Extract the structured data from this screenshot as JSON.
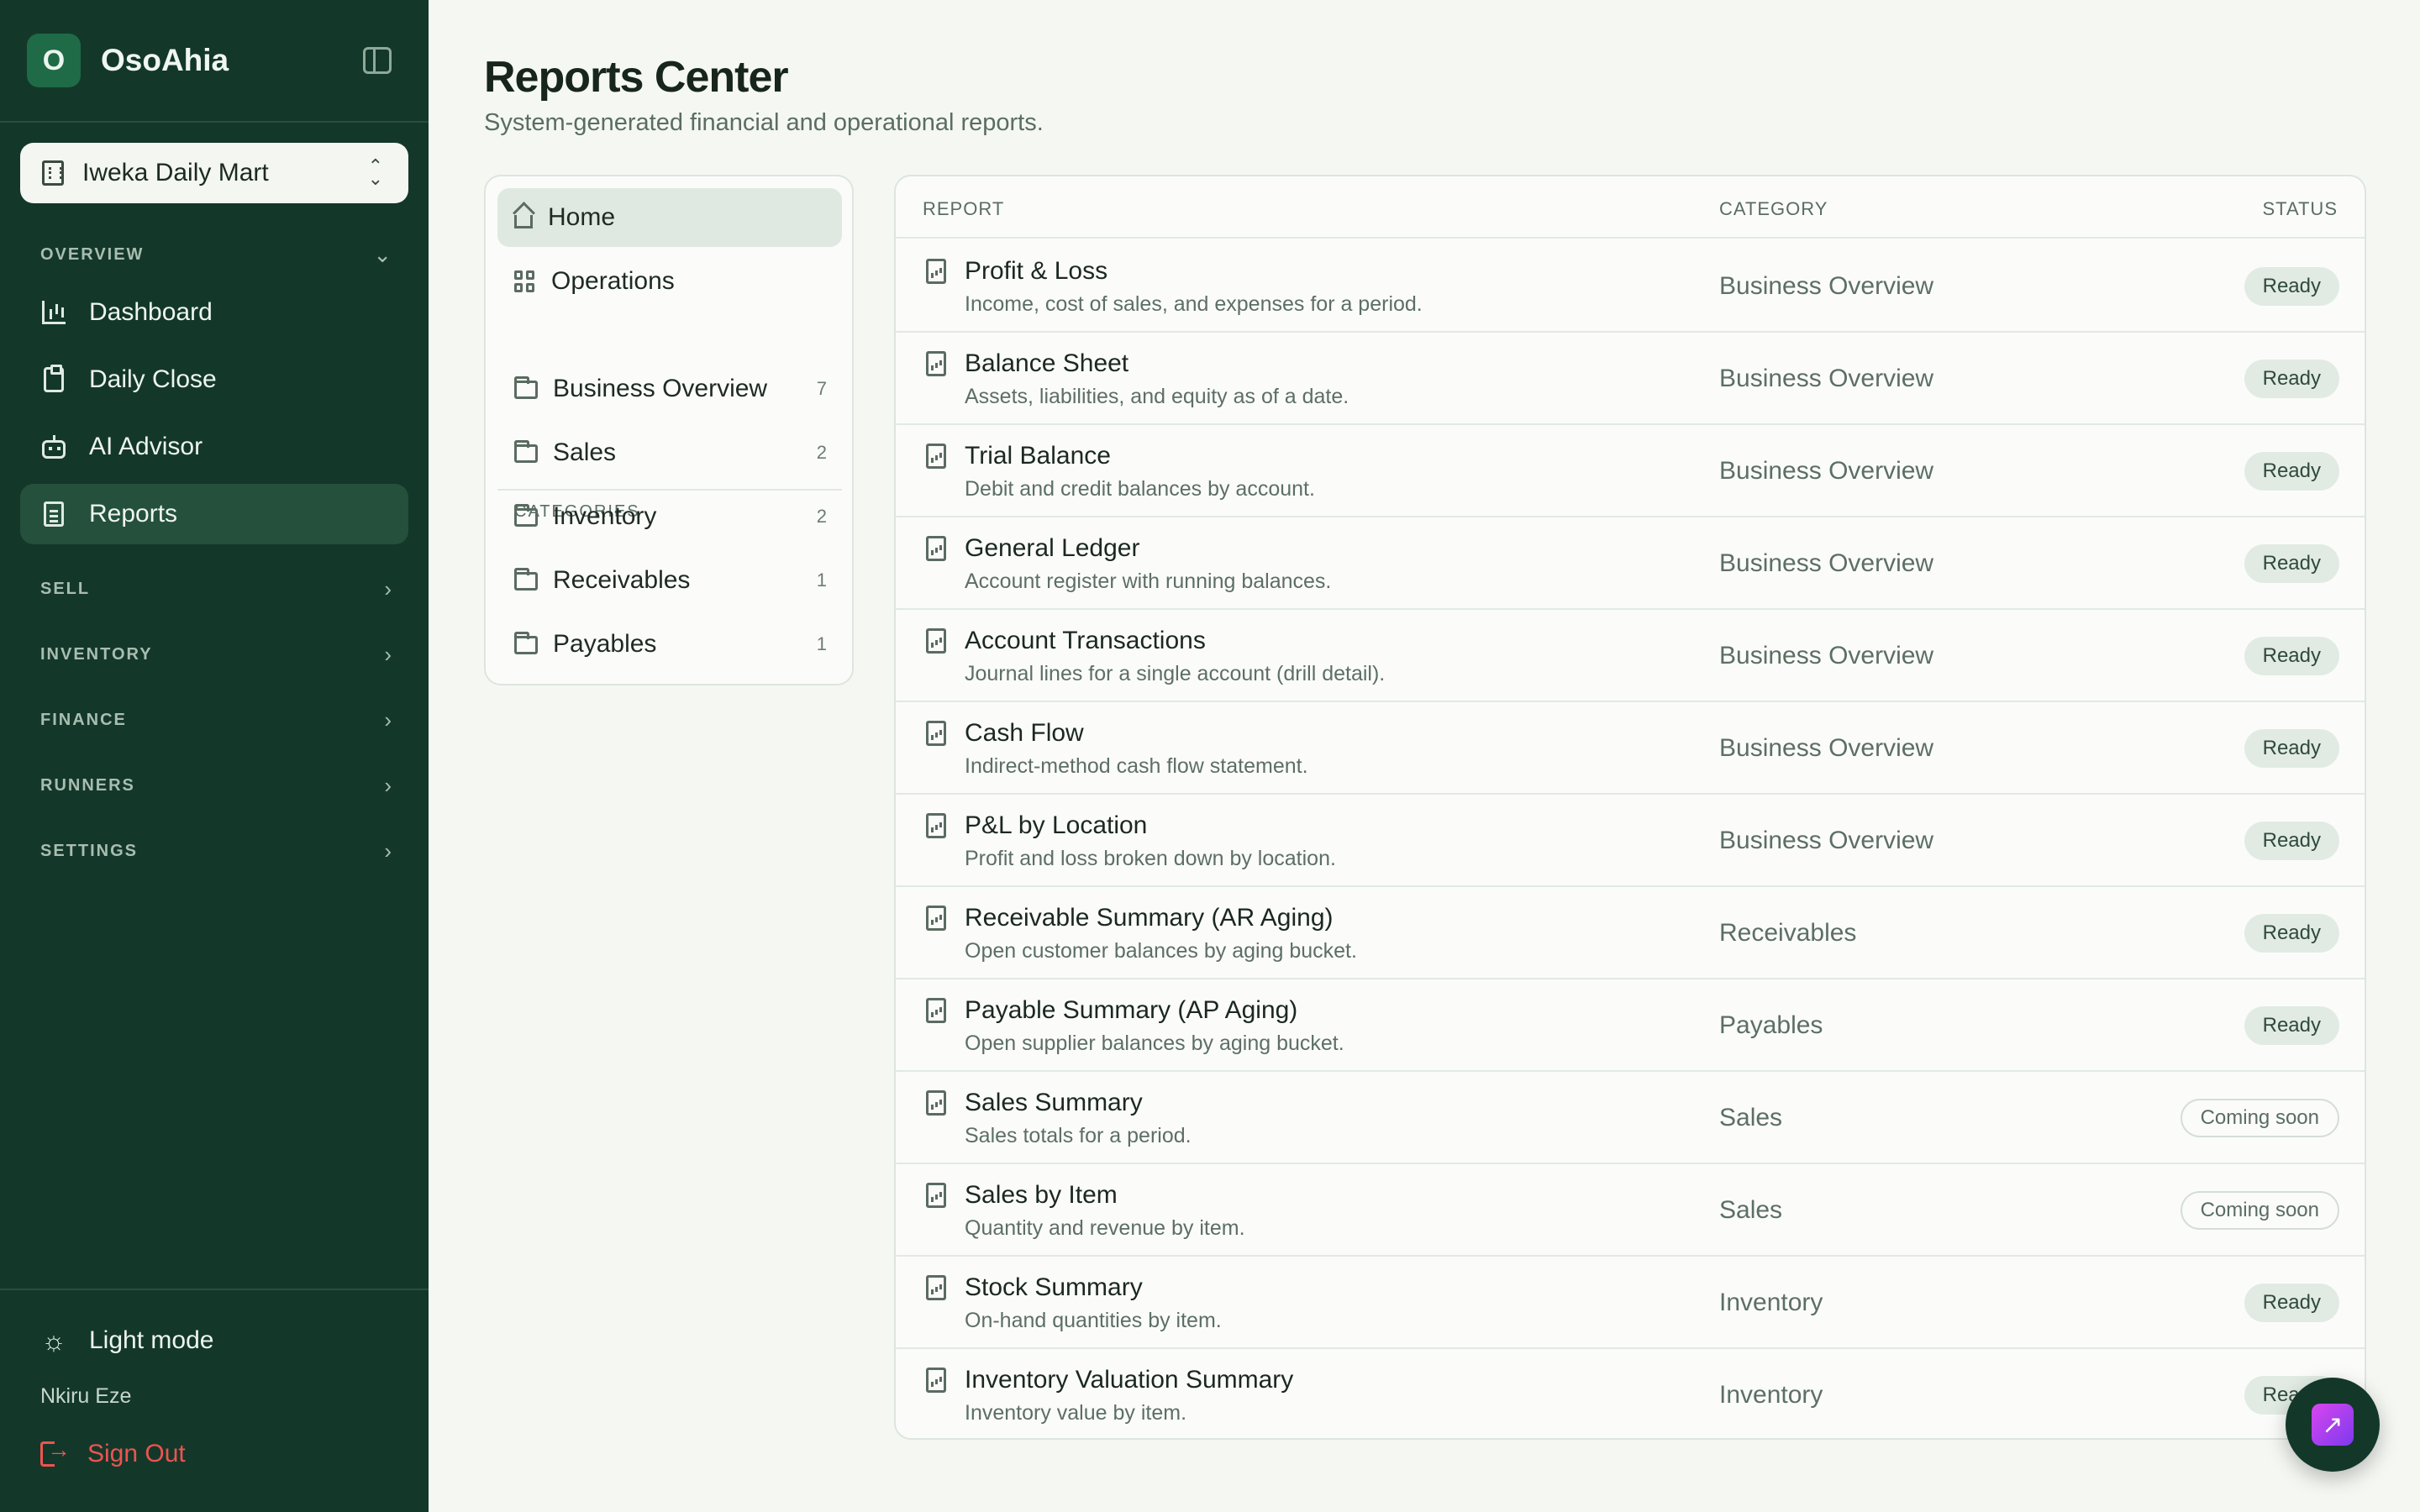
{
  "sidebar": {
    "brand_initial": "O",
    "brand_name": "OsoAhia",
    "store": "Iweka Daily Mart",
    "sections": {
      "overview": "OVERVIEW",
      "sell": "SELL",
      "inventory": "INVENTORY",
      "finance": "FINANCE",
      "runners": "RUNNERS",
      "settings": "SETTINGS"
    },
    "items": [
      {
        "label": "Dashboard",
        "icon": "bar-chart-icon"
      },
      {
        "label": "Daily Close",
        "icon": "clipboard-check-icon"
      },
      {
        "label": "AI Advisor",
        "icon": "bot-icon"
      },
      {
        "label": "Reports",
        "icon": "file-text-icon",
        "active": true
      }
    ],
    "theme_toggle": "Light mode",
    "user_name": "Nkiru Eze",
    "sign_out": "Sign Out"
  },
  "header": {
    "title": "Reports Center",
    "subtitle": "System-generated financial and operational reports."
  },
  "categories_panel": {
    "home": "Home",
    "operations": "Operations",
    "heading": "CATEGORIES",
    "items": [
      {
        "label": "Business Overview",
        "count": "7"
      },
      {
        "label": "Sales",
        "count": "2"
      },
      {
        "label": "Inventory",
        "count": "2"
      },
      {
        "label": "Receivables",
        "count": "1"
      },
      {
        "label": "Payables",
        "count": "1"
      }
    ]
  },
  "table": {
    "columns": {
      "report": "REPORT",
      "category": "CATEGORY",
      "status": "STATUS"
    },
    "rows": [
      {
        "name": "Profit & Loss",
        "desc": "Income, cost of sales, and expenses for a period.",
        "category": "Business Overview",
        "status": "Ready"
      },
      {
        "name": "Balance Sheet",
        "desc": "Assets, liabilities, and equity as of a date.",
        "category": "Business Overview",
        "status": "Ready"
      },
      {
        "name": "Trial Balance",
        "desc": "Debit and credit balances by account.",
        "category": "Business Overview",
        "status": "Ready"
      },
      {
        "name": "General Ledger",
        "desc": "Account register with running balances.",
        "category": "Business Overview",
        "status": "Ready"
      },
      {
        "name": "Account Transactions",
        "desc": "Journal lines for a single account (drill detail).",
        "category": "Business Overview",
        "status": "Ready"
      },
      {
        "name": "Cash Flow",
        "desc": "Indirect-method cash flow statement.",
        "category": "Business Overview",
        "status": "Ready"
      },
      {
        "name": "P&L by Location",
        "desc": "Profit and loss broken down by location.",
        "category": "Business Overview",
        "status": "Ready"
      },
      {
        "name": "Receivable Summary (AR Aging)",
        "desc": "Open customer balances by aging bucket.",
        "category": "Receivables",
        "status": "Ready"
      },
      {
        "name": "Payable Summary (AP Aging)",
        "desc": "Open supplier balances by aging bucket.",
        "category": "Payables",
        "status": "Ready"
      },
      {
        "name": "Sales Summary",
        "desc": "Sales totals for a period.",
        "category": "Sales",
        "status": "Coming soon"
      },
      {
        "name": "Sales by Item",
        "desc": "Quantity and revenue by item.",
        "category": "Sales",
        "status": "Coming soon"
      },
      {
        "name": "Stock Summary",
        "desc": "On-hand quantities by item.",
        "category": "Inventory",
        "status": "Ready"
      },
      {
        "name": "Inventory Valuation Summary",
        "desc": "Inventory value by item.",
        "category": "Inventory",
        "status": "Ready"
      }
    ]
  },
  "colors": {
    "sidebar_bg": "#13382a",
    "accent": "#1f6a47",
    "danger": "#ef5350",
    "fab_gradient": [
      "#d946ef",
      "#7c3aed"
    ]
  }
}
